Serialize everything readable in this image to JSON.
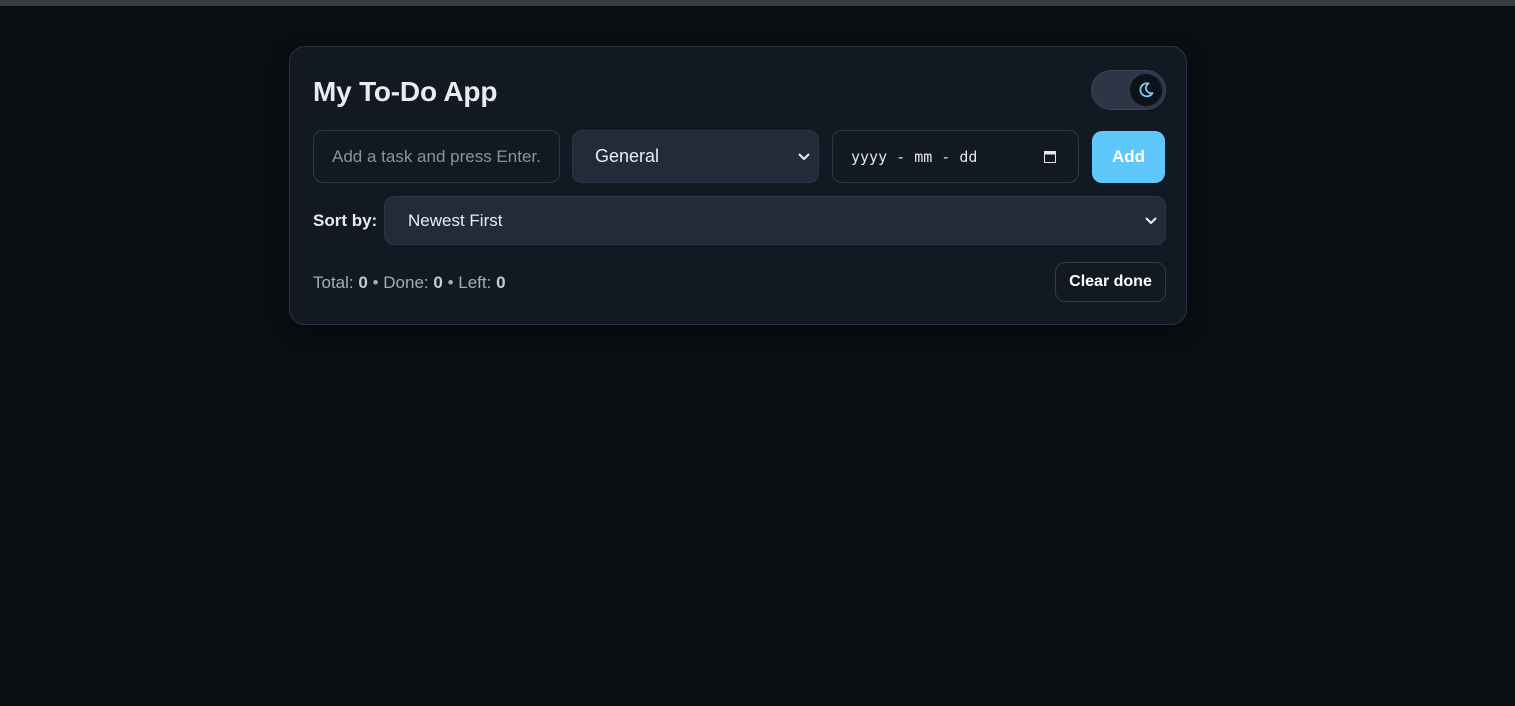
{
  "app": {
    "title": "My To-Do App",
    "theme_toggle": {
      "mode": "dark",
      "icon": "moon-icon"
    }
  },
  "form": {
    "task_placeholder": "Add a task and press Enter...",
    "category_selected": "General",
    "date_placeholder": "yyyy - mm - dd",
    "add_label": "Add"
  },
  "sort": {
    "label": "Sort by:",
    "selected": "Newest First"
  },
  "stats": {
    "total_label": "Total:",
    "total": "0",
    "done_label": "Done:",
    "done": "0",
    "left_label": "Left:",
    "left": "0",
    "separator": "•"
  },
  "actions": {
    "clear_done_label": "Clear done"
  },
  "colors": {
    "background": "#0b0e13",
    "card": "#121923",
    "accent": "#5ec8fd",
    "moon": "#7dcdf7"
  }
}
